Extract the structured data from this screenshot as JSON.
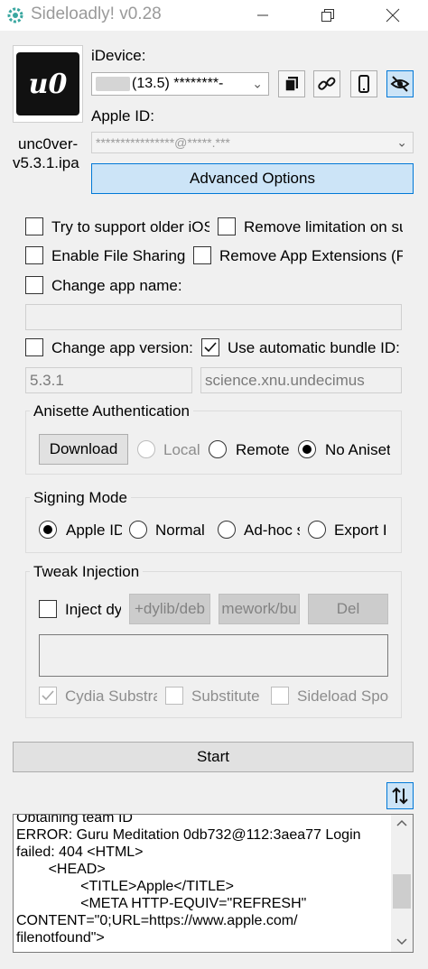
{
  "window": {
    "title": "Sideloadly! v0.28",
    "minimize_icon": "minimize-icon",
    "maximize_icon": "maximize-icon",
    "close_icon": "close-icon"
  },
  "app": {
    "icon_text": "u0",
    "file_name_line1": "unc0ver-",
    "file_name_line2": "v5.3.1.ipa"
  },
  "device": {
    "label": "iDevice:",
    "value": "(13.5) ********-"
  },
  "toolbar_icons": [
    "copy-icon",
    "link-icon",
    "phone-icon",
    "hide-eye-icon"
  ],
  "apple_id": {
    "label": "Apple ID:",
    "value": "****************@*****.***"
  },
  "advanced_options_label": "Advanced Options",
  "options": {
    "older_ios": "Try to support older iOS",
    "remove_limitation": "Remove limitation on su",
    "file_sharing": "Enable File Sharing",
    "remove_extensions": "Remove App Extensions (Pl",
    "change_name": "Change app name:",
    "change_version": "Change app version:",
    "auto_bundle": "Use automatic bundle ID:",
    "version_value": "5.3.1",
    "bundle_value": "science.xnu.undecimus"
  },
  "anisette": {
    "title": "Anisette Authentication",
    "download_label": "Download",
    "local_label": "Local",
    "remote_label": "Remote",
    "none_label": "No Aniset",
    "selected": "No Anisette"
  },
  "signing": {
    "title": "Signing Mode",
    "apple_id_label": "Apple ID",
    "normal_label": "Normal",
    "adhoc_label": "Ad-hoc s",
    "export_label": "Export I",
    "selected": "Apple ID"
  },
  "tweak": {
    "title": "Tweak Injection",
    "inject_label": "Inject dy",
    "add_dylib_label": "+dylib/deb",
    "add_framework_label": "mework/bu",
    "del_label": "Del",
    "cydia_label": "Cydia Substra",
    "substitute_label": "Substitute",
    "sideload_label": "Sideload Spoo"
  },
  "start_label": "Start",
  "sort_icon": "sort-arrows-icon",
  "log": {
    "lines": [
      "Obtaining team ID",
      "ERROR: Guru Meditation 0db732@112:3aea77 Login",
      "failed: 404 <HTML>",
      "        <HEAD>",
      "                <TITLE>Apple</TITLE>",
      "                <META HTTP-EQUIV=\"REFRESH\"",
      "CONTENT=\"0;URL=https://www.apple.com/",
      "filenotfound\">"
    ]
  },
  "colors": {
    "accent": "#0078d7",
    "accent_bg": "#cce4f7",
    "window_bg": "#f0f0f0"
  }
}
